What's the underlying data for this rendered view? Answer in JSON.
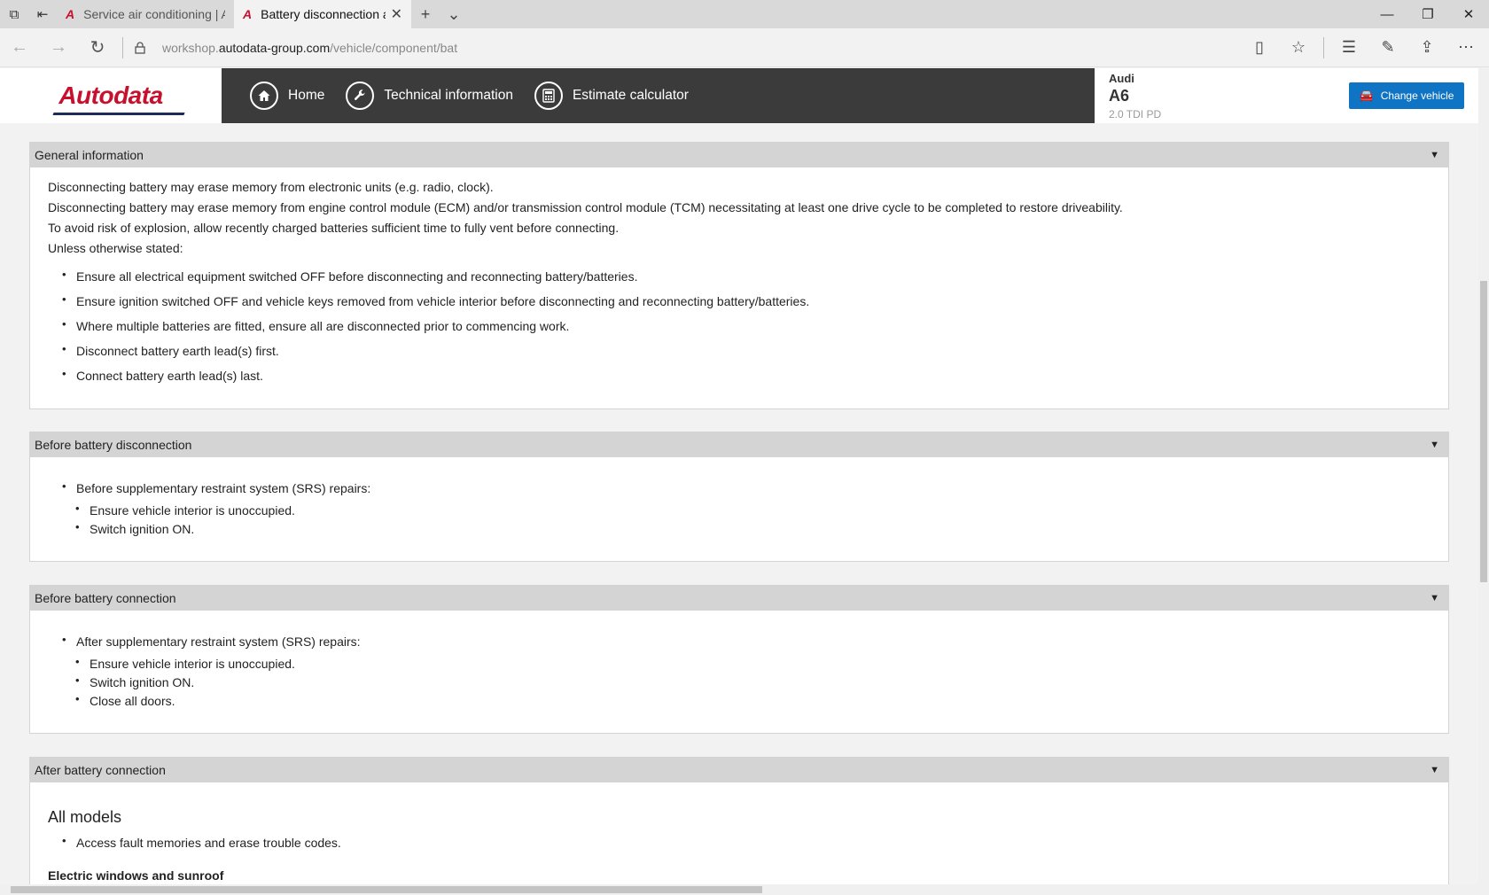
{
  "browser": {
    "tabs": [
      {
        "title": "Service air conditioning | Au",
        "active": false
      },
      {
        "title": "Battery disconnection a",
        "active": true
      }
    ],
    "url_host_prefix": "workshop.",
    "url_host": "autodata-group.com",
    "url_path": "/vehicle/component/bat"
  },
  "header": {
    "logo_text": "Autodata",
    "nav": [
      {
        "label": "Home",
        "icon": "home-icon"
      },
      {
        "label": "Technical information",
        "icon": "wrench-icon"
      },
      {
        "label": "Estimate calculator",
        "icon": "calculator-icon"
      }
    ],
    "vehicle": {
      "make": "Audi",
      "model": "A6",
      "engine": "2.0 TDI PD"
    },
    "change_vehicle_label": "Change vehicle"
  },
  "sections": {
    "general": {
      "title": "General information",
      "lines": [
        "Disconnecting battery may erase memory from electronic units (e.g. radio, clock).",
        "Disconnecting battery may erase memory from engine control module (ECM) and/or transmission control module (TCM) necessitating at least one drive cycle to be completed to restore driveability.",
        "To avoid risk of explosion, allow recently charged batteries sufficient time to fully vent before connecting.",
        "Unless otherwise stated:"
      ],
      "bullets": [
        "Ensure all electrical equipment switched OFF before disconnecting and reconnecting battery/batteries.",
        "Ensure ignition switched OFF and vehicle keys removed from vehicle interior before disconnecting and reconnecting battery/batteries.",
        "Where multiple batteries are fitted, ensure all are disconnected prior to commencing work.",
        "Disconnect battery earth lead(s) first.",
        "Connect battery earth lead(s) last."
      ]
    },
    "before_disconnection": {
      "title": "Before battery disconnection",
      "lead": "Before supplementary restraint system (SRS) repairs:",
      "items": [
        "Ensure vehicle interior is unoccupied.",
        "Switch ignition ON."
      ]
    },
    "before_connection": {
      "title": "Before battery connection",
      "lead": "After supplementary restraint system (SRS) repairs:",
      "items": [
        "Ensure vehicle interior is unoccupied.",
        "Switch ignition ON.",
        "Close all doors."
      ]
    },
    "after_connection": {
      "title": "After battery connection",
      "subtitle": "All models",
      "items": [
        "Access fault memories and erase trouble codes."
      ],
      "next_heading": "Electric windows and sunroof"
    }
  }
}
